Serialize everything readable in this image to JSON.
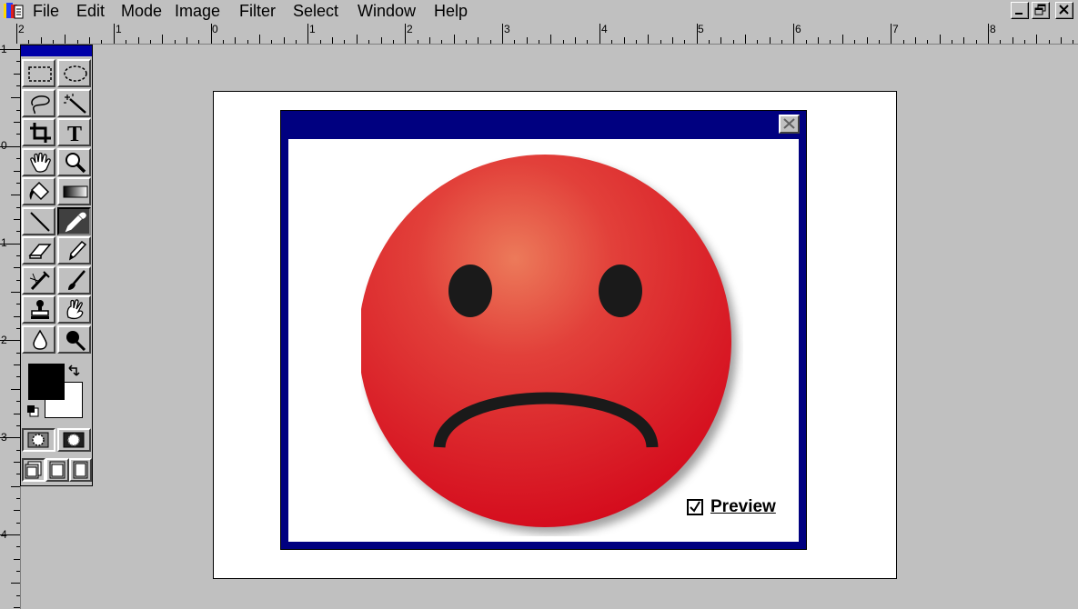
{
  "menubar": {
    "items": [
      "File",
      "Edit",
      "Mode",
      "Image",
      "Filter",
      "Select",
      "Window",
      "Help"
    ]
  },
  "rulers": {
    "horizontal_labels": [
      "2",
      "1",
      "0",
      "1",
      "2",
      "3",
      "4",
      "5",
      "6",
      "7",
      "8"
    ],
    "vertical_labels": [
      "1",
      "0",
      "1",
      "2",
      "3",
      "4"
    ]
  },
  "toolbox": {
    "tools": [
      {
        "name": "rectangular-marquee",
        "icon": "rect-marquee-icon"
      },
      {
        "name": "elliptical-marquee",
        "icon": "ellipse-marquee-icon"
      },
      {
        "name": "lasso",
        "icon": "lasso-icon"
      },
      {
        "name": "magic-wand",
        "icon": "magic-wand-icon"
      },
      {
        "name": "crop",
        "icon": "crop-icon"
      },
      {
        "name": "type",
        "icon": "type-icon",
        "label": "T"
      },
      {
        "name": "hand",
        "icon": "hand-icon"
      },
      {
        "name": "zoom",
        "icon": "magnifier-icon"
      },
      {
        "name": "paint-bucket",
        "icon": "paint-bucket-icon"
      },
      {
        "name": "gradient",
        "icon": "gradient-icon"
      },
      {
        "name": "line",
        "icon": "line-icon"
      },
      {
        "name": "eyedropper",
        "icon": "eyedropper-icon",
        "active": true
      },
      {
        "name": "eraser",
        "icon": "eraser-icon"
      },
      {
        "name": "pencil",
        "icon": "pencil-icon"
      },
      {
        "name": "airbrush",
        "icon": "airbrush-icon"
      },
      {
        "name": "paintbrush",
        "icon": "paintbrush-icon"
      },
      {
        "name": "rubber-stamp",
        "icon": "stamp-icon"
      },
      {
        "name": "smudge",
        "icon": "smudge-icon"
      },
      {
        "name": "blur",
        "icon": "drop-icon"
      },
      {
        "name": "burn",
        "icon": "burn-icon"
      }
    ],
    "foreground_color": "#000000",
    "background_color": "#ffffff"
  },
  "dialog": {
    "preview_label": "Preview",
    "preview_checked": true,
    "title_color": "#000080"
  },
  "face": {
    "fill_color": "#e0282c",
    "feature_color": "#1a1a1a"
  }
}
